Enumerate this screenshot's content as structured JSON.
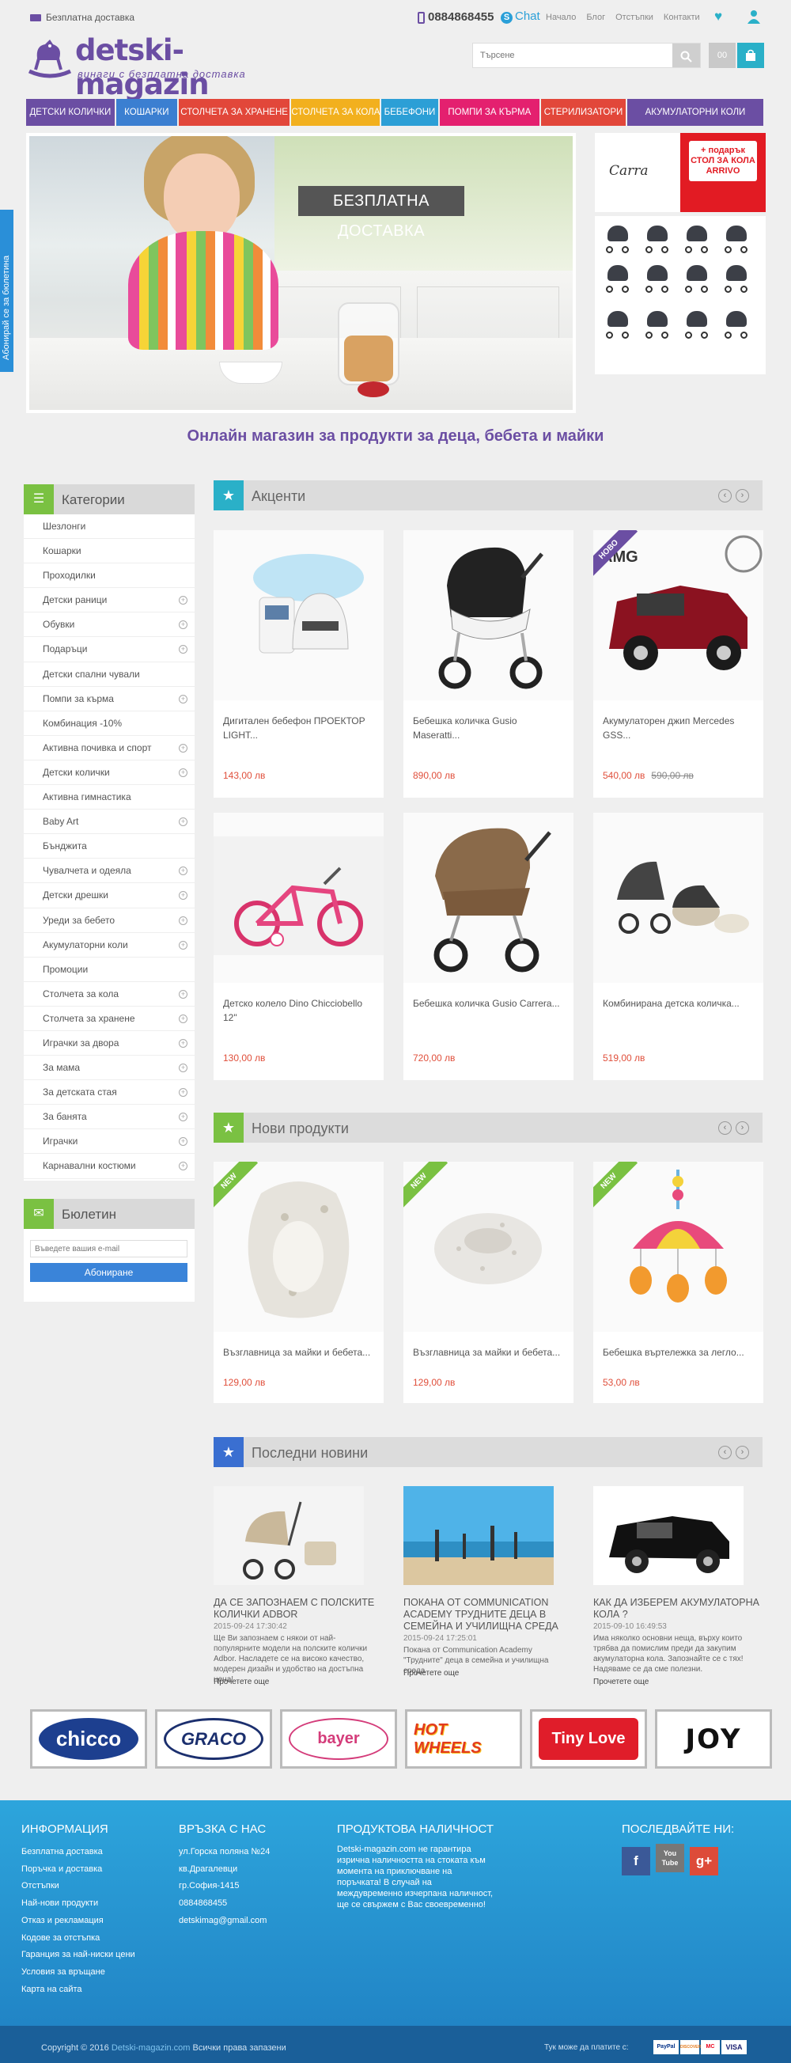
{
  "header": {
    "shipping_text": "Безплатна доставка",
    "phone": "0884868455",
    "chat": "Chat",
    "top_links": [
      "Начало",
      "Блог",
      "Отстъпки",
      "Контакти"
    ],
    "logo_name": "detski-magazin",
    "logo_slogan": "винаги с безплатна доставка",
    "search_placeholder": "Търсене",
    "cart_count": "00"
  },
  "nav": {
    "items": [
      {
        "label": "ДЕТСКИ КОЛИЧКИ",
        "color": "#6b4ea3"
      },
      {
        "label": "КОШАРКИ",
        "color": "#3b7fd1"
      },
      {
        "label": "СТОЛЧЕТА ЗА ХРАНЕНЕ",
        "color": "#e2473a"
      },
      {
        "label": "СТОЛЧЕТА ЗА КОЛА",
        "color": "#f2b01e"
      },
      {
        "label": "БЕБЕФОНИ",
        "color": "#2c9fd6"
      },
      {
        "label": "ПОМПИ ЗА КЪРМА",
        "color": "#e4206f"
      },
      {
        "label": "СТЕРИЛИЗАТОРИ",
        "color": "#e2473a"
      },
      {
        "label": "АКУМУЛАТОРНИ КОЛИ",
        "color": "#6b4ea3"
      }
    ]
  },
  "hero": {
    "banner": "БЕЗПЛАТНА ДОСТАВКА"
  },
  "promo": {
    "brand": "Carra",
    "gift_line1": "+ подарък",
    "gift_line2": "СТОЛ ЗА КОЛА",
    "gift_line3": "ARRIVO"
  },
  "newsletter_tab": "Абонирай се за бюлетина",
  "slogan": "Онлайн магазин за продукти за деца, бебета и майки",
  "categories": {
    "title": "Категории",
    "items": [
      {
        "label": "Шезлонги",
        "sub": false
      },
      {
        "label": "Кошарки",
        "sub": false
      },
      {
        "label": "Проходилки",
        "sub": false
      },
      {
        "label": "Детски раници",
        "sub": true
      },
      {
        "label": "Обувки",
        "sub": true
      },
      {
        "label": "Подаръци",
        "sub": true
      },
      {
        "label": "Детски спални чували",
        "sub": false
      },
      {
        "label": "Помпи за кърма",
        "sub": true
      },
      {
        "label": "Комбинация -10%",
        "sub": false
      },
      {
        "label": "Активна почивка и спорт",
        "sub": true
      },
      {
        "label": "Детски колички",
        "sub": true
      },
      {
        "label": "Активна гимнастика",
        "sub": false
      },
      {
        "label": "Baby Art",
        "sub": true
      },
      {
        "label": "Бънджита",
        "sub": false
      },
      {
        "label": "Чувалчета и одеяла",
        "sub": true
      },
      {
        "label": "Детски дрешки",
        "sub": true
      },
      {
        "label": "Уреди за бебето",
        "sub": true
      },
      {
        "label": "Акумулаторни коли",
        "sub": true
      },
      {
        "label": "Промоции",
        "sub": false
      },
      {
        "label": "Столчета за кола",
        "sub": true
      },
      {
        "label": "Столчета за хранене",
        "sub": true
      },
      {
        "label": "Играчки за двора",
        "sub": true
      },
      {
        "label": "За мама",
        "sub": true
      },
      {
        "label": "За детската стая",
        "sub": true
      },
      {
        "label": "За банята",
        "sub": true
      },
      {
        "label": "Играчки",
        "sub": true
      },
      {
        "label": "Карнавални костюми",
        "sub": true
      }
    ]
  },
  "newsletter": {
    "title": "Бюлетин",
    "placeholder": "Въведете вашия e-mail",
    "button": "Абониране"
  },
  "featured": {
    "title": "Акценти",
    "prev": "‹",
    "next": "›",
    "products": [
      {
        "name": "Дигитален бебефон ПРОЕКТОР LIGHT...",
        "price": "143,00 лв",
        "old_price": "",
        "badge": ""
      },
      {
        "name": "Бебешка количка Gusio Maseratti...",
        "price": "890,00 лв",
        "old_price": "",
        "badge": ""
      },
      {
        "name": "Акумулаторен джип Mercedes GSS...",
        "price": "540,00 лв",
        "old_price": "590,00 лв",
        "badge": "НОВО"
      },
      {
        "name": "Детско колело Dino Chicciobello 12\"",
        "price": "130,00 лв",
        "old_price": "",
        "badge": ""
      },
      {
        "name": "Бебешка количка Gusio Carrera...",
        "price": "720,00 лв",
        "old_price": "",
        "badge": ""
      },
      {
        "name": "Комбинирана детска количка...",
        "price": "519,00 лв",
        "old_price": "",
        "badge": ""
      }
    ]
  },
  "new_products": {
    "title": "Нови продукти",
    "prev": "‹",
    "next": "›",
    "products": [
      {
        "name": "Възглавница за майки и бебета...",
        "price": "129,00 лв",
        "badge": "NEW"
      },
      {
        "name": "Възглавница за майки и бебета...",
        "price": "129,00 лв",
        "badge": "NEW"
      },
      {
        "name": "Бебешка въртележка за легло...",
        "price": "53,00 лв",
        "badge": "NEW"
      }
    ]
  },
  "latest_news": {
    "title": "Последни новини",
    "prev": "‹",
    "next": "›",
    "items": [
      {
        "title": "ДА СЕ ЗАПОЗНАЕМ С ПОЛСКИТЕ КОЛИЧКИ ADBOR",
        "date": "2015-09-24 17:30:42",
        "desc": "Ще Ви запознаем с някои от най-популярните модели на полските колички Adbor. Насладете се на високо качество, модерен дизайн и удобство на достъпна цена!",
        "more": "Прочетете още"
      },
      {
        "title": "ПОКАНА ОТ COMMUNICATION ACADEMY ТРУДНИТЕ ДЕЦА В СЕМЕЙНА И УЧИЛИЩНА СРЕДА",
        "date": "2015-09-24 17:25:01",
        "desc": "Покана от Communication Academy \"Трудните\" деца в семейна и училищна среда",
        "more": "Прочетете още"
      },
      {
        "title": "КАК ДА ИЗБЕРЕМ АКУМУЛАТОРНА КОЛА ?",
        "date": "2015-09-10 16:49:53",
        "desc": "Има няколко основни неща, върху които трябва да помислим преди да закупим акумулаторна кола. Запознайте се с тях! Надяваме се да сме полезни.",
        "more": "Прочетете още"
      }
    ]
  },
  "brands": [
    "chicco",
    "GRACO",
    "bayer",
    "HOT WHEELS",
    "Tiny Love",
    "JOY"
  ],
  "footer": {
    "info": {
      "title": "ИНФОРМАЦИЯ",
      "links": [
        "Безплатна доставка",
        "Поръчка и доставка",
        "Отстъпки",
        "Най-нови продукти",
        "Отказ и рекламация",
        "Кодове за отстъпка",
        "Гаранция за най-ниски цени",
        "Условия за връщане",
        "Карта на сайта"
      ]
    },
    "contact": {
      "title": "ВРЪЗКА С НАС",
      "lines": [
        "ул.Горска поляна №24",
        "кв.Драгалевци",
        "гр.София-1415",
        "0884868455",
        "detskimag@gmail.com"
      ]
    },
    "availability": {
      "title": "ПРОДУКТОВА НАЛИЧНОСТ",
      "text": "Detski-magazin.com не гарантира изрична наличността на стоката към момента на приключване на поръчката! В случай на междувременно изчерпана наличност, ще се свържем с Вас своевременно!"
    },
    "social": {
      "title": "ПОСЛЕДВАЙТЕ НИ:",
      "icons": [
        "f",
        "You Tube",
        "g+"
      ]
    }
  },
  "copyright": {
    "prefix": "Copyright © 2016",
    "site": "Detski-magazin.com",
    "suffix": "Всички права запазени",
    "pay_label": "Тук може да платите с:",
    "payments": [
      "PayPal",
      "DISCOVER",
      "MC",
      "VISA"
    ]
  }
}
